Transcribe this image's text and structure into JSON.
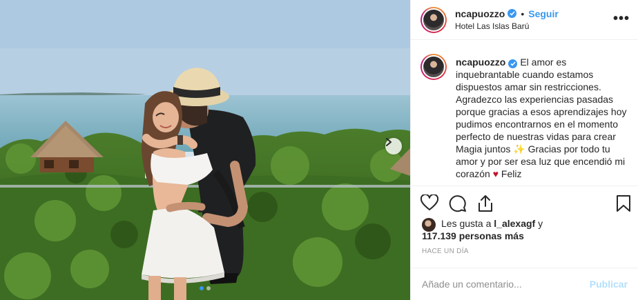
{
  "post": {
    "username": "ncapuozzo",
    "separator": "•",
    "follow_label": "Seguir",
    "location": "Hotel Las Islas Barú",
    "more_icon": "more-options-icon"
  },
  "caption": {
    "username": "ncapuozzo",
    "text": "El amor es inquebrantable cuando estamos dispuestos amar sin restricciones. Agradezco las experiencias pasadas porque gracias a esos aprendizajes hoy pudimos encontrarnos en el momento perfecto de nuestras vidas para crear Magia juntos ✨ Gracias por todo tu amor y por ser esa luz que encendió mi corazón ♥ Feliz"
  },
  "likes": {
    "prefix": "Les gusta a",
    "first_user": "l_alexagf",
    "connector": "y",
    "others": "117.139 personas más"
  },
  "timestamp": "HACE UN DÍA",
  "comment": {
    "placeholder": "Añade un comentario...",
    "publish_label": "Publicar"
  },
  "carousel": {
    "slide_count": 2,
    "active_slide": 1
  },
  "colors": {
    "accent": "#3897f0",
    "publish_disabled": "#b2dffc",
    "heart_emoji": "#c0142c"
  }
}
